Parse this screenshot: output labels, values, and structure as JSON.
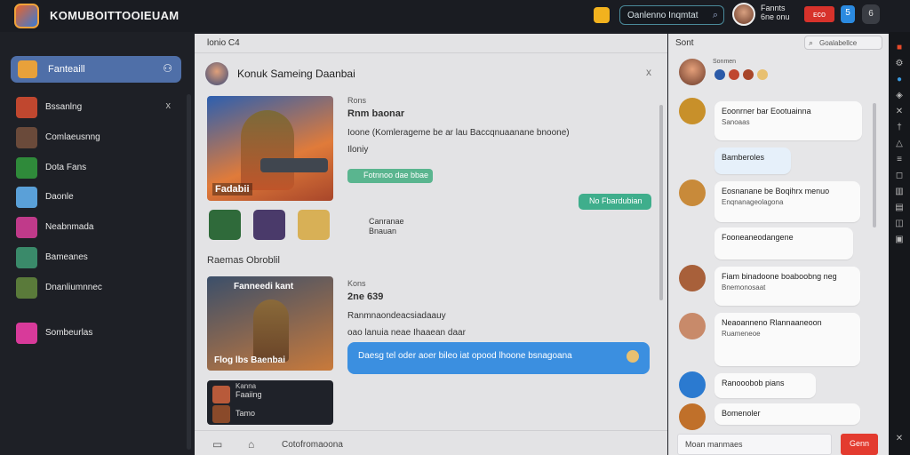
{
  "app": {
    "name": "KOMUBOITTOOIEUAM"
  },
  "top": {
    "search_placeholder": "Oanlenno Inqmtat",
    "user_line1": "Fannts",
    "user_line2": "6ne onu",
    "red_button": "ᴇᴄᴏ",
    "blue_button": "5",
    "grey_button": "6"
  },
  "sidebar": {
    "active_label": "Fanteaill",
    "items": [
      {
        "label": "Bssanlng",
        "icon": "game-thumbnail-icon",
        "color": "#c0472f"
      },
      {
        "label": "Comlaeusnng",
        "icon": "game-thumbnail-icon",
        "color": "#6a4a3a"
      },
      {
        "label": "Dota Fans",
        "icon": "game-thumbnail-icon",
        "color": "#2f8a3a"
      },
      {
        "label": "Daonle",
        "icon": "game-thumbnail-icon",
        "color": "#5aa0d8"
      },
      {
        "label": "Neabnmada",
        "icon": "game-thumbnail-icon",
        "color": "#c03a8a"
      },
      {
        "label": "Bameanes",
        "icon": "game-thumbnail-icon",
        "color": "#3a8a6a"
      },
      {
        "label": "Dnanliumnnec",
        "icon": "game-thumbnail-icon",
        "color": "#5a7a3a"
      },
      {
        "label": "Sombeurlas",
        "icon": "game-thumbnail-icon",
        "color": "#d83a9a"
      }
    ],
    "first_item_close": "x"
  },
  "main": {
    "header": "lonio  C4",
    "chat_title": "Konuk   Sameing Daanbai",
    "close": "x",
    "post1": {
      "image_tag": "Fadabii",
      "small": "Rons",
      "title": "Rnm baonar",
      "row1": "Ioone  (Komlerageme be ar lau Baccqnuaanane bnoone)",
      "row2": "Iloniy",
      "pill": "Fotnnoo dae bbae",
      "thumb_text_line1": "Canranae",
      "thumb_text_line2": "Bnauan"
    },
    "teal_pill": "No Fbardubian",
    "section_label": "Raemas Obroblil",
    "post2": {
      "image_title": "Fanneedi kant",
      "image_caption": "Flog lbs Baenbai",
      "small": "Kons",
      "title": "2ne 639",
      "row1": "Ranmnaondeacsiadaauy",
      "row2": "oao   lanuia  neae Ihaaean daar"
    },
    "blue_msg": "Daesg tel oder aoer bileo iat opood lhoone bsnagoana",
    "card3": {
      "l1": "Kanna",
      "l2": "Faaiing",
      "l3": "Tamo"
    },
    "footer_text": "Cotofromaoona"
  },
  "right": {
    "title": "Sont",
    "search_placeholder": "Goalabellce",
    "top_label": "Sonmen",
    "messages": [
      {
        "text": "Eoonrner bar Eootuainna",
        "sub": "Sanoaas"
      },
      {
        "text": "Bamberoles",
        "sub": ""
      },
      {
        "text": "Eosnanane be Boqihrx menuo",
        "sub": "Enqnanageolagona"
      },
      {
        "text": "Fooneaneodangene",
        "sub": ""
      },
      {
        "text": "Fiam binadoone boaboobng neg",
        "sub": "Bnemonosaat"
      },
      {
        "text": "Neaoanneno Rlannaaneoon",
        "sub": "Ruameneoe"
      },
      {
        "text": "Ranooobob pians",
        "sub": ""
      },
      {
        "text": "Bomenoler",
        "sub": ""
      }
    ],
    "input_placeholder": "Moan manmaes",
    "send": "Genn"
  }
}
